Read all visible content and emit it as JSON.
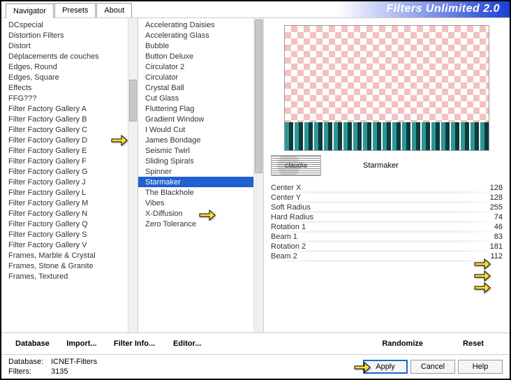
{
  "app_title": "Filters Unlimited 2.0",
  "tabs": [
    "Navigator",
    "Presets",
    "About"
  ],
  "active_tab": 0,
  "categories": [
    "DCspecial",
    "Distortion Filters",
    "Distort",
    "Déplacements de couches",
    "Edges, Round",
    "Edges, Square",
    "Effects",
    "FFG???",
    "Filter Factory Gallery A",
    "Filter Factory Gallery B",
    "Filter Factory Gallery C",
    "Filter Factory Gallery D",
    "Filter Factory Gallery E",
    "Filter Factory Gallery F",
    "Filter Factory Gallery G",
    "Filter Factory Gallery J",
    "Filter Factory Gallery L",
    "Filter Factory Gallery M",
    "Filter Factory Gallery N",
    "Filter Factory Gallery Q",
    "Filter Factory Gallery S",
    "Filter Factory Gallery V",
    "Frames, Marble & Crystal",
    "Frames, Stone & Granite",
    "Frames, Textured"
  ],
  "category_highlight_idx": 9,
  "filters": [
    "Accelerating Daisies",
    "Accelerating Glass",
    "Bubble",
    "Button Deluxe",
    "Circulator 2",
    "Circulator",
    "Crystal Ball",
    "Cut Glass",
    "Fluttering Flag",
    "Gradient Window",
    "I Would Cut",
    "James Bondage",
    "Seismic Twirl",
    "Sliding Spirals",
    "Spinner",
    "Starmaker",
    "The Blackhole",
    "Vibes",
    "X-Diffusion",
    "Zero Tolerance"
  ],
  "filter_selected_idx": 15,
  "filter_name": "Starmaker",
  "logo_text": "claudia",
  "params": [
    {
      "label": "Center X",
      "value": 128
    },
    {
      "label": "Center Y",
      "value": 128
    },
    {
      "label": "Soft Radius",
      "value": 255
    },
    {
      "label": "Hard Radius",
      "value": 74
    },
    {
      "label": "Rotation 1",
      "value": 46
    },
    {
      "label": "Beam 1",
      "value": 83
    },
    {
      "label": "Rotation 2",
      "value": 181
    },
    {
      "label": "Beam 2",
      "value": 112
    }
  ],
  "buttons_top": {
    "database": "Database",
    "import": "Import...",
    "filter_info": "Filter Info...",
    "editor": "Editor...",
    "randomize": "Randomize",
    "reset": "Reset"
  },
  "buttons_bottom": {
    "apply": "Apply",
    "cancel": "Cancel",
    "help": "Help"
  },
  "status": {
    "db_label": "Database:",
    "db_val": "ICNET-Filters",
    "filters_label": "Filters:",
    "filters_val": "3135"
  }
}
